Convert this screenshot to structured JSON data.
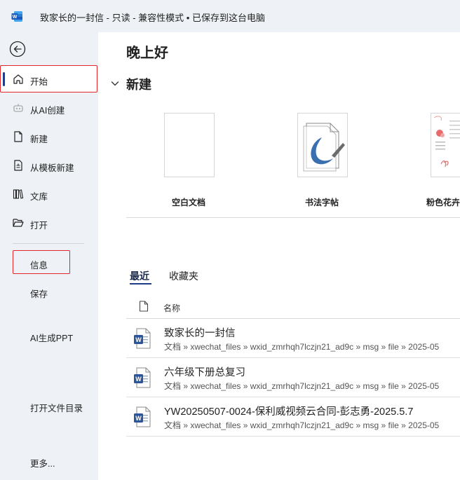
{
  "titlebar": {
    "doc_name": "致家长的一封信",
    "sep1": " - ",
    "mode": "只读",
    "sep2": " - ",
    "compat": "兼容性模式",
    "sep3": " • ",
    "saved": "已保存到这台电脑",
    "logo_icon": "word-icon"
  },
  "sidebar": {
    "back_icon": "back-arrow-icon",
    "items": [
      {
        "label": "开始",
        "icon": "home-icon"
      },
      {
        "label": "从AI创建",
        "icon": "ai-create-icon"
      },
      {
        "label": "新建",
        "icon": "new-doc-icon"
      },
      {
        "label": "从模板新建",
        "icon": "template-icon"
      },
      {
        "label": "文库",
        "icon": "library-icon"
      },
      {
        "label": "打开",
        "icon": "folder-open-icon"
      }
    ],
    "lower_items": [
      {
        "label": "信息"
      },
      {
        "label": "保存"
      },
      {
        "label": "AI生成PPT"
      },
      {
        "label": "打开文件目录"
      },
      {
        "label": "更多..."
      }
    ]
  },
  "main": {
    "greeting": "晚上好",
    "new_section": {
      "title": "新建",
      "templates": [
        {
          "label": "空白文档"
        },
        {
          "label": "书法字帖"
        },
        {
          "label": "粉色花卉"
        }
      ]
    },
    "tabs": [
      {
        "label": "最近",
        "active": true
      },
      {
        "label": "收藏夹",
        "active": false
      }
    ],
    "file_list": {
      "column_name": "名称",
      "rows": [
        {
          "name": "致家长的一封信",
          "path": "文档 » xwechat_files » wxid_zmrhqh7lczjn21_ad9c » msg » file » 2025-05"
        },
        {
          "name": "六年级下册总复习",
          "path": "文档 » xwechat_files » wxid_zmrhqh7lczjn21_ad9c » msg » file » 2025-05"
        },
        {
          "name": "YW20250507-0024-保利威视频云合同-彭志勇-2025.5.7",
          "path": "文档 » xwechat_files » wxid_zmrhqh7lczjn21_ad9c » msg » file » 2025-05"
        }
      ]
    }
  },
  "colors": {
    "sidebar_bg": "#eef2f6",
    "accent": "#1f3c88",
    "highlight_box": "#e3262c",
    "word_blue": "#2b579a"
  }
}
